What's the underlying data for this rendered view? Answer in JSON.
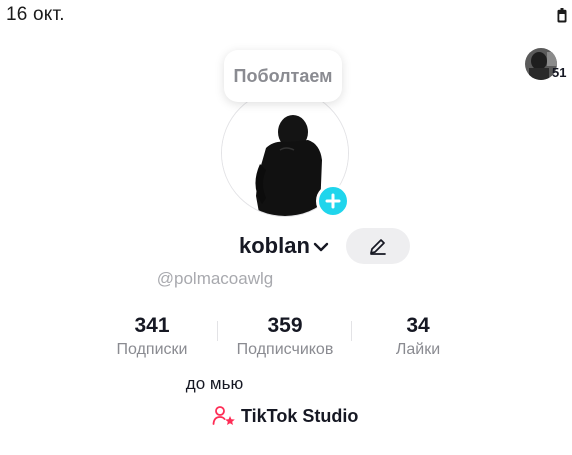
{
  "status_bar": {
    "date": "16 окт.",
    "icon": "battery-icon"
  },
  "friends": {
    "count": "51",
    "icon": "friends-avatar"
  },
  "bubble": {
    "text": "Поболтаем"
  },
  "profile": {
    "username": "koblan",
    "handle": "@polmacoawlg",
    "bio": "до мью",
    "accent": "#20d5ec",
    "studio_accent": "#fe2c55"
  },
  "stats": [
    {
      "value": "341",
      "label": "Подписки"
    },
    {
      "value": "359",
      "label": "Подписчиков"
    },
    {
      "value": "34",
      "label": "Лайки"
    }
  ],
  "studio": {
    "label": "TikTok Studio",
    "icon": "creator-person-star-icon"
  }
}
